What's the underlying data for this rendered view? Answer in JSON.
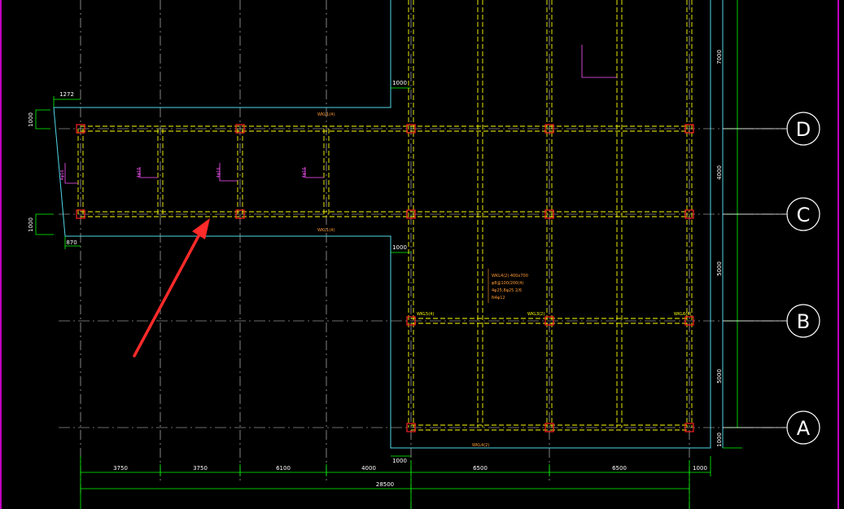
{
  "drawing": {
    "axes": [
      {
        "id": "D",
        "label": "D"
      },
      {
        "id": "C",
        "label": "C"
      },
      {
        "id": "B",
        "label": "B"
      },
      {
        "id": "A",
        "label": "A"
      }
    ],
    "bottom_dimensions": [
      "3750",
      "3750",
      "6100",
      "4000",
      "6500",
      "6500",
      "1000"
    ],
    "total_dimension": "28500",
    "right_dimensions": [
      "7000",
      "4000",
      "5000",
      "5000",
      "1000"
    ],
    "left_dimensions": [
      "1000",
      "1000"
    ],
    "side_offsets": [
      "1272",
      "870"
    ],
    "offset_marks": [
      "1000",
      "1000",
      "1000"
    ],
    "beam_labels": [
      "WKL1(4)",
      "WKL1(4)",
      "WKL4(2)",
      "WKL3(2)",
      "WKL5(4)",
      "WKL6(4)"
    ],
    "column_tags": [
      "4φ16",
      "4φ16",
      "4φ16",
      "4φ16"
    ],
    "annotation_block": [
      "WKL4(2) 400x700",
      "φ8@100/200(4)",
      "4φ25;8φ25 2/6",
      "N4φ12"
    ],
    "colors": {
      "grid": "#ffffff",
      "slab_outline": "#4fd8e8",
      "beam": "#ffff00",
      "column": "#ff2020",
      "dim_line": "#00ff00",
      "annotation": "#ff9933",
      "magenta": "#ff55ff",
      "frame": "#ff00ff",
      "arrow": "#ff2a2a"
    }
  }
}
